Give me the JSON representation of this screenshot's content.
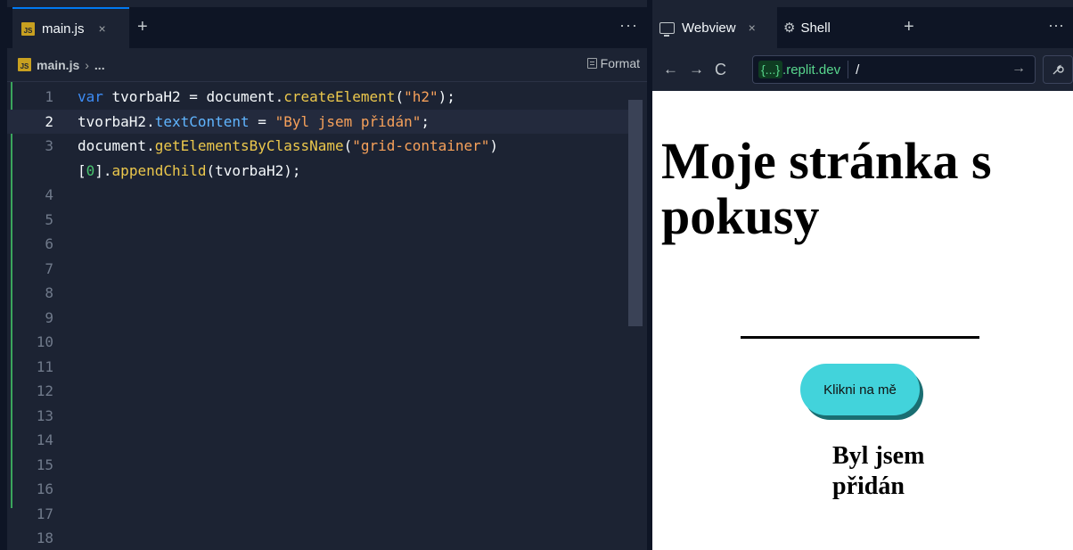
{
  "editor": {
    "tab": {
      "badge": "JS",
      "filename": "main.js",
      "close": "×"
    },
    "add_tab": "+",
    "more": "···",
    "breadcrumb": {
      "badge": "JS",
      "file": "main.js",
      "separator": "›",
      "ellipsis": "..."
    },
    "format_label": "Format",
    "lines": [
      {
        "n": "1",
        "tokens": [
          {
            "t": "var",
            "c": "kw"
          },
          {
            "t": " tvorbaH2 = "
          },
          {
            "t": "document"
          },
          {
            "t": "."
          },
          {
            "t": "createElement",
            "c": "fn"
          },
          {
            "t": "("
          },
          {
            "t": "\"h2\"",
            "c": "str"
          },
          {
            "t": ");"
          }
        ]
      },
      {
        "n": "2",
        "active": true,
        "tokens": [
          {
            "t": "tvorbaH2"
          },
          {
            "t": "."
          },
          {
            "t": "textContent",
            "c": "prop"
          },
          {
            "t": " = "
          },
          {
            "t": "\"Byl jsem přidán\"",
            "c": "str"
          },
          {
            "t": ";"
          }
        ]
      },
      {
        "n": "3",
        "tokens": [
          {
            "t": "document"
          },
          {
            "t": "."
          },
          {
            "t": "getElementsByClassName",
            "c": "fn"
          },
          {
            "t": "("
          },
          {
            "t": "\"grid-container\"",
            "c": "str"
          },
          {
            "t": ")"
          }
        ]
      },
      {
        "n": "",
        "tokens": [
          {
            "t": "["
          },
          {
            "t": "0",
            "c": "num"
          },
          {
            "t": "]."
          },
          {
            "t": "appendChild",
            "c": "fn"
          },
          {
            "t": "(tvorbaH2);"
          }
        ]
      },
      {
        "n": "4",
        "tokens": []
      },
      {
        "n": "5",
        "tokens": []
      },
      {
        "n": "6",
        "tokens": []
      },
      {
        "n": "7",
        "tokens": []
      },
      {
        "n": "8",
        "tokens": []
      },
      {
        "n": "9",
        "tokens": []
      },
      {
        "n": "10",
        "tokens": []
      },
      {
        "n": "11",
        "tokens": []
      },
      {
        "n": "12",
        "tokens": []
      },
      {
        "n": "13",
        "tokens": []
      },
      {
        "n": "14",
        "tokens": []
      },
      {
        "n": "15",
        "tokens": []
      },
      {
        "n": "16",
        "tokens": []
      },
      {
        "n": "17",
        "tokens": []
      },
      {
        "n": "18",
        "tokens": []
      }
    ]
  },
  "preview": {
    "tabs": {
      "webview": "Webview",
      "close": "×",
      "shell": "Shell",
      "add": "+",
      "more": "···"
    },
    "nav": {
      "back": "←",
      "forward": "→",
      "reload": "C"
    },
    "url": {
      "badge": "{...}",
      "domain": ".replit.dev",
      "path": "/",
      "go": "→"
    },
    "tools_icon": "wrench-icon",
    "page": {
      "heading": "Moje stránka s pokusy",
      "button_label": "Klikni na mě",
      "added_heading": "Byl jsem přidán"
    }
  },
  "colors": {
    "accent_tab": "#0079f2",
    "button_bg": "#42d3db",
    "git_added": "#3aa55c"
  }
}
